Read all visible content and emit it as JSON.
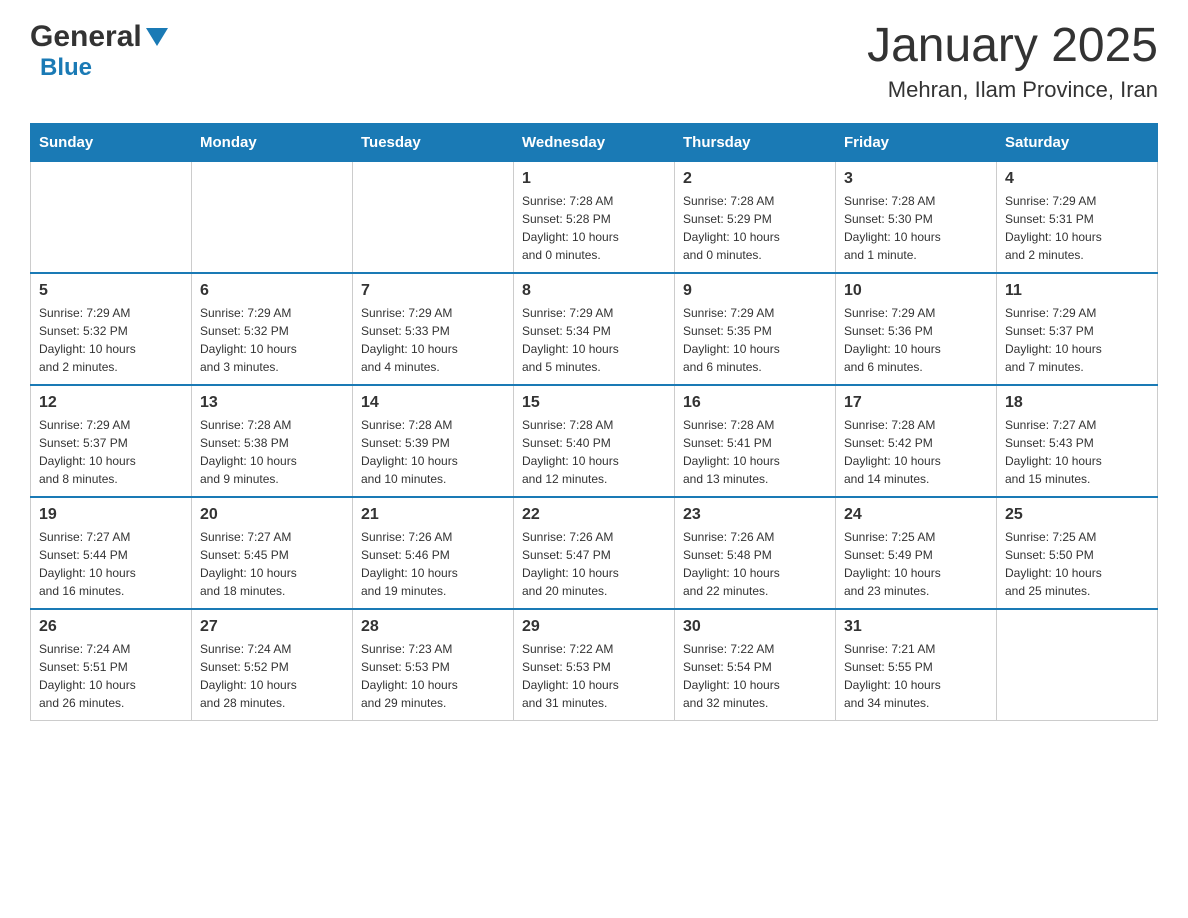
{
  "header": {
    "logo_general": "General",
    "logo_blue": "Blue",
    "title": "January 2025",
    "subtitle": "Mehran, Ilam Province, Iran"
  },
  "days_of_week": [
    "Sunday",
    "Monday",
    "Tuesday",
    "Wednesday",
    "Thursday",
    "Friday",
    "Saturday"
  ],
  "weeks": [
    [
      {
        "day": "",
        "info": ""
      },
      {
        "day": "",
        "info": ""
      },
      {
        "day": "",
        "info": ""
      },
      {
        "day": "1",
        "info": "Sunrise: 7:28 AM\nSunset: 5:28 PM\nDaylight: 10 hours\nand 0 minutes."
      },
      {
        "day": "2",
        "info": "Sunrise: 7:28 AM\nSunset: 5:29 PM\nDaylight: 10 hours\nand 0 minutes."
      },
      {
        "day": "3",
        "info": "Sunrise: 7:28 AM\nSunset: 5:30 PM\nDaylight: 10 hours\nand 1 minute."
      },
      {
        "day": "4",
        "info": "Sunrise: 7:29 AM\nSunset: 5:31 PM\nDaylight: 10 hours\nand 2 minutes."
      }
    ],
    [
      {
        "day": "5",
        "info": "Sunrise: 7:29 AM\nSunset: 5:32 PM\nDaylight: 10 hours\nand 2 minutes."
      },
      {
        "day": "6",
        "info": "Sunrise: 7:29 AM\nSunset: 5:32 PM\nDaylight: 10 hours\nand 3 minutes."
      },
      {
        "day": "7",
        "info": "Sunrise: 7:29 AM\nSunset: 5:33 PM\nDaylight: 10 hours\nand 4 minutes."
      },
      {
        "day": "8",
        "info": "Sunrise: 7:29 AM\nSunset: 5:34 PM\nDaylight: 10 hours\nand 5 minutes."
      },
      {
        "day": "9",
        "info": "Sunrise: 7:29 AM\nSunset: 5:35 PM\nDaylight: 10 hours\nand 6 minutes."
      },
      {
        "day": "10",
        "info": "Sunrise: 7:29 AM\nSunset: 5:36 PM\nDaylight: 10 hours\nand 6 minutes."
      },
      {
        "day": "11",
        "info": "Sunrise: 7:29 AM\nSunset: 5:37 PM\nDaylight: 10 hours\nand 7 minutes."
      }
    ],
    [
      {
        "day": "12",
        "info": "Sunrise: 7:29 AM\nSunset: 5:37 PM\nDaylight: 10 hours\nand 8 minutes."
      },
      {
        "day": "13",
        "info": "Sunrise: 7:28 AM\nSunset: 5:38 PM\nDaylight: 10 hours\nand 9 minutes."
      },
      {
        "day": "14",
        "info": "Sunrise: 7:28 AM\nSunset: 5:39 PM\nDaylight: 10 hours\nand 10 minutes."
      },
      {
        "day": "15",
        "info": "Sunrise: 7:28 AM\nSunset: 5:40 PM\nDaylight: 10 hours\nand 12 minutes."
      },
      {
        "day": "16",
        "info": "Sunrise: 7:28 AM\nSunset: 5:41 PM\nDaylight: 10 hours\nand 13 minutes."
      },
      {
        "day": "17",
        "info": "Sunrise: 7:28 AM\nSunset: 5:42 PM\nDaylight: 10 hours\nand 14 minutes."
      },
      {
        "day": "18",
        "info": "Sunrise: 7:27 AM\nSunset: 5:43 PM\nDaylight: 10 hours\nand 15 minutes."
      }
    ],
    [
      {
        "day": "19",
        "info": "Sunrise: 7:27 AM\nSunset: 5:44 PM\nDaylight: 10 hours\nand 16 minutes."
      },
      {
        "day": "20",
        "info": "Sunrise: 7:27 AM\nSunset: 5:45 PM\nDaylight: 10 hours\nand 18 minutes."
      },
      {
        "day": "21",
        "info": "Sunrise: 7:26 AM\nSunset: 5:46 PM\nDaylight: 10 hours\nand 19 minutes."
      },
      {
        "day": "22",
        "info": "Sunrise: 7:26 AM\nSunset: 5:47 PM\nDaylight: 10 hours\nand 20 minutes."
      },
      {
        "day": "23",
        "info": "Sunrise: 7:26 AM\nSunset: 5:48 PM\nDaylight: 10 hours\nand 22 minutes."
      },
      {
        "day": "24",
        "info": "Sunrise: 7:25 AM\nSunset: 5:49 PM\nDaylight: 10 hours\nand 23 minutes."
      },
      {
        "day": "25",
        "info": "Sunrise: 7:25 AM\nSunset: 5:50 PM\nDaylight: 10 hours\nand 25 minutes."
      }
    ],
    [
      {
        "day": "26",
        "info": "Sunrise: 7:24 AM\nSunset: 5:51 PM\nDaylight: 10 hours\nand 26 minutes."
      },
      {
        "day": "27",
        "info": "Sunrise: 7:24 AM\nSunset: 5:52 PM\nDaylight: 10 hours\nand 28 minutes."
      },
      {
        "day": "28",
        "info": "Sunrise: 7:23 AM\nSunset: 5:53 PM\nDaylight: 10 hours\nand 29 minutes."
      },
      {
        "day": "29",
        "info": "Sunrise: 7:22 AM\nSunset: 5:53 PM\nDaylight: 10 hours\nand 31 minutes."
      },
      {
        "day": "30",
        "info": "Sunrise: 7:22 AM\nSunset: 5:54 PM\nDaylight: 10 hours\nand 32 minutes."
      },
      {
        "day": "31",
        "info": "Sunrise: 7:21 AM\nSunset: 5:55 PM\nDaylight: 10 hours\nand 34 minutes."
      },
      {
        "day": "",
        "info": ""
      }
    ]
  ]
}
